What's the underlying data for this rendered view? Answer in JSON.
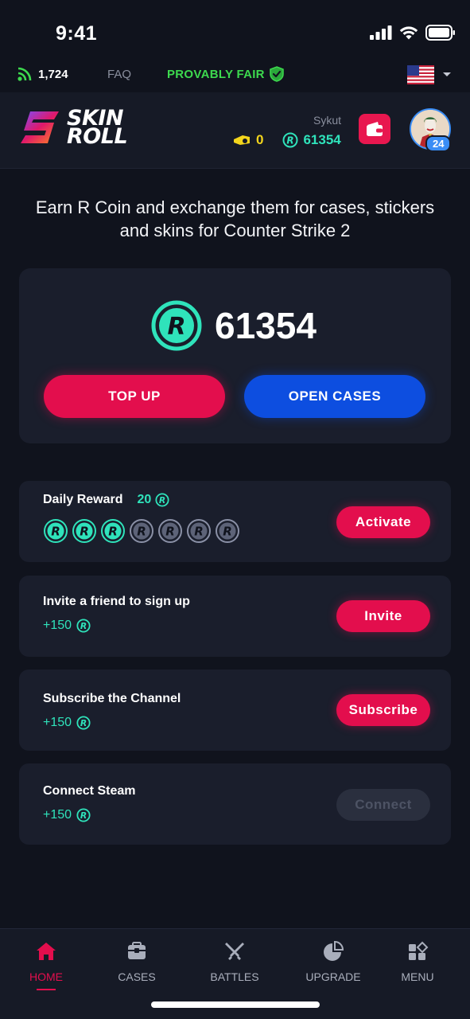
{
  "status_bar": {
    "time": "9:41"
  },
  "info_bar": {
    "online_count": "1,724",
    "faq_label": "FAQ",
    "provably_fair_label": "PROVABLY FAIR",
    "language_flag": "us-flag-icon"
  },
  "header": {
    "logo_line1": "SKIN",
    "logo_line2": "ROLL",
    "username": "Sykut",
    "tickets": "0",
    "coins": "61354",
    "level": "24"
  },
  "intro_text": "Earn R Coin and exchange them for cases, stickers and skins for Counter Strike 2",
  "balance_card": {
    "balance": "61354",
    "top_up_label": "TOP UP",
    "open_cases_label": "OPEN CASES"
  },
  "tasks": {
    "daily": {
      "title": "Daily Reward",
      "amount": "20",
      "claimed_days": 3,
      "total_days": 7,
      "button_label": "Activate"
    },
    "invite": {
      "title": "Invite a friend to sign up",
      "reward": "+150",
      "button_label": "Invite"
    },
    "subscribe": {
      "title": "Subscribe the Channel",
      "reward": "+150",
      "button_label": "Subscribe"
    },
    "steam": {
      "title": "Connect Steam",
      "reward": "+150",
      "button_label": "Connect",
      "enabled": false
    }
  },
  "nav": {
    "home": "HOME",
    "cases": "CASES",
    "battles": "BATTLES",
    "upgrade": "UPGRADE",
    "menu": "MENU",
    "active": "home"
  },
  "colors": {
    "background": "#10131d",
    "card": "#1a1e2c",
    "accent_red": "#e30e4d",
    "accent_blue": "#0d4ee0",
    "coin_teal": "#2fe3bb",
    "fair_green": "#3dd94e"
  }
}
